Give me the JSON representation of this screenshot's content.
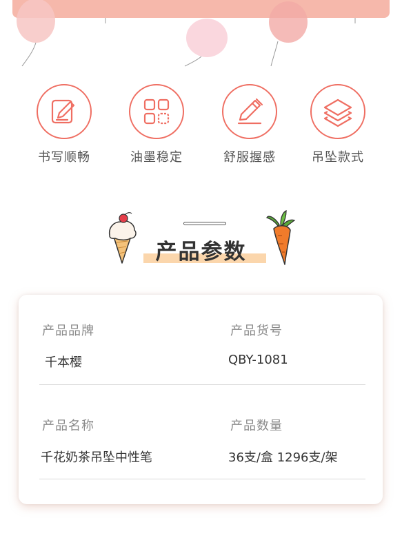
{
  "features": [
    {
      "label": "书写顺畅",
      "icon": "pencil-paper-icon"
    },
    {
      "label": "油墨稳定",
      "icon": "grid-squares-icon"
    },
    {
      "label": "舒服握感",
      "icon": "pen-icon"
    },
    {
      "label": "吊坠款式",
      "icon": "layers-icon"
    }
  ],
  "section": {
    "title": "产品参数"
  },
  "params": [
    {
      "key": "产品品牌",
      "value": "千本樱"
    },
    {
      "key": "产品货号",
      "value": "QBY-1081"
    },
    {
      "key": "产品名称",
      "value": "千花奶茶吊坠中性笔"
    },
    {
      "key": "产品数量",
      "value": "36支/盒 1296支/架"
    }
  ],
  "colors": {
    "accent": "#ef6e62",
    "banner": "#f6b8ab",
    "highlight": "#fbd6ac"
  }
}
